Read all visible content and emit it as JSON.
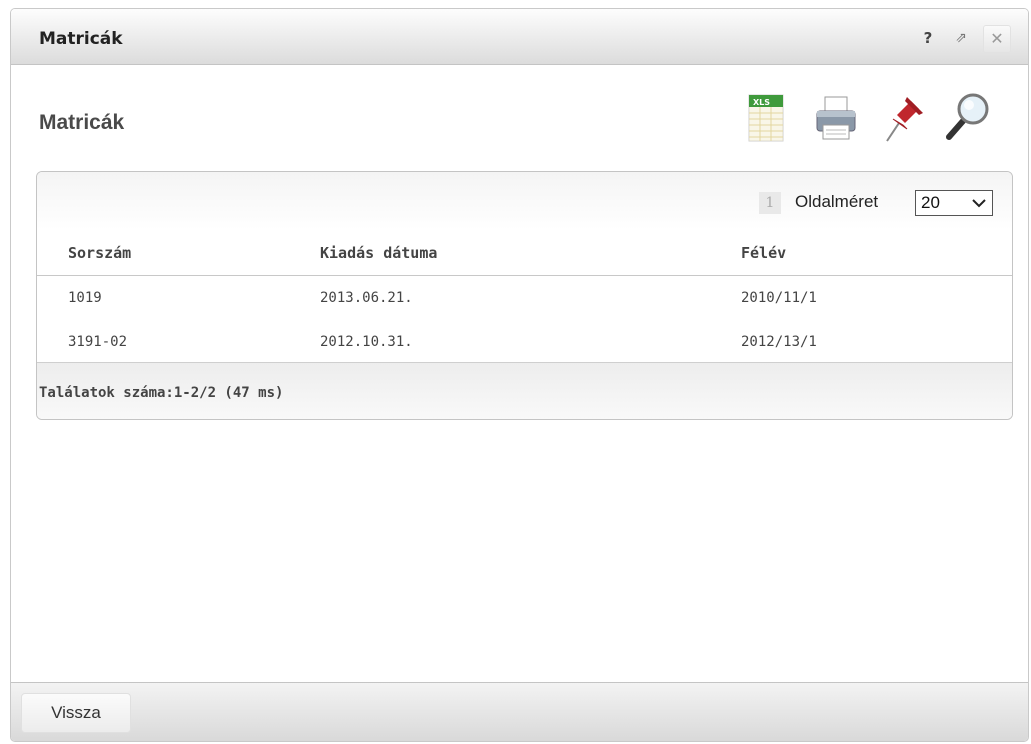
{
  "window": {
    "title": "Matricák",
    "help_icon": "help-icon",
    "help_glyph": "?",
    "popout_icon": "popout-icon",
    "popout_glyph": "⇗",
    "close_icon": "close-icon",
    "close_glyph": "✕"
  },
  "page": {
    "title": "Matricák"
  },
  "toolbar": {
    "icons": [
      "xls-export-icon",
      "print-icon",
      "pin-icon",
      "search-icon"
    ],
    "xls_badge": "XLS"
  },
  "grid": {
    "pager": {
      "current_page": "1",
      "page_size_label": "Oldalméret",
      "page_size_value": "20"
    },
    "columns": [
      "Sorszám",
      "Kiadás dátuma",
      "Félév"
    ],
    "rows": [
      [
        "1019",
        "2013.06.21.",
        "2010/11/1"
      ],
      [
        "3191-02",
        "2012.10.31.",
        "2012/13/1"
      ]
    ],
    "result_count": "Találatok száma:1-2/2 (47 ms)"
  },
  "footer": {
    "back_label": "Vissza"
  }
}
